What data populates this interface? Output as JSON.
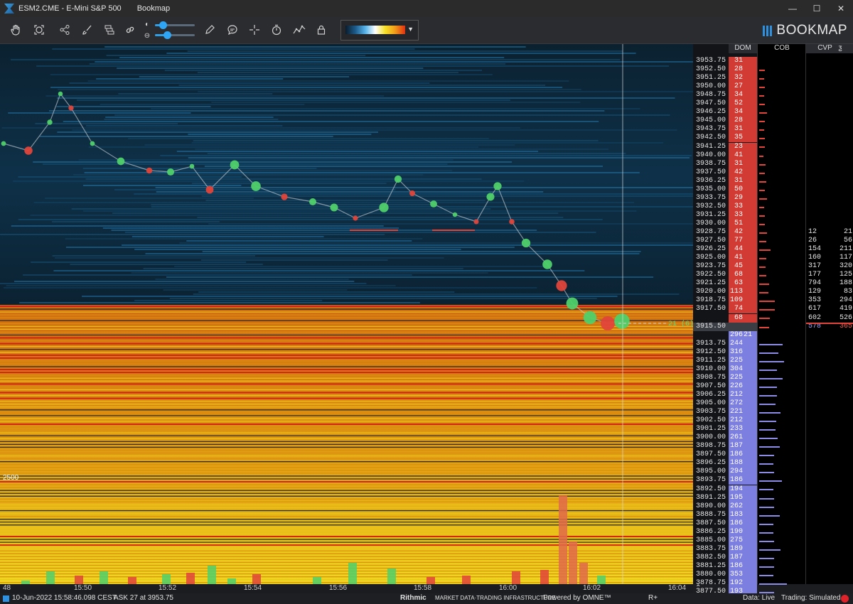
{
  "window": {
    "instrument_title": "ESM2.CME - E-Mini S&P 500",
    "app_name": "Bookmap",
    "minimize": "—",
    "maximize": "☐",
    "close": "✕"
  },
  "toolbar": {
    "icons": [
      "hand-icon",
      "target-icon",
      "share-icon",
      "brush-icon",
      "layers-icon",
      "link-icon",
      "pencil-icon",
      "chat-icon",
      "crosshair-icon",
      "stopwatch-icon",
      "line-chart-icon",
      "lock-icon"
    ],
    "brightness_slider_level": 0.2,
    "contrast_slider_level": 0.3,
    "heatmap_gradient": [
      "#0a1c2c",
      "#1d5a8a",
      "#57b3e8",
      "#ffffff",
      "#f6e027",
      "#f09a1a",
      "#e03010"
    ]
  },
  "brand": {
    "logo_text": "BOOKMAP",
    "accent": "#2e90e0"
  },
  "chart": {
    "left_label": "2500",
    "crosshair_readout": "21 (6)",
    "colors": {
      "buy": "#4fd06a",
      "sell": "#e0443a",
      "bid_bar": "#8c8ce6",
      "ask_bar": "#e0443a"
    }
  },
  "columns": {
    "dom": "DOM",
    "cob": "COB",
    "cvp": "CVP",
    "cvp_icon": "ƺ"
  },
  "ladder": [
    {
      "price": "3953.75",
      "size": "31",
      "side": "ask"
    },
    {
      "price": "3952.50",
      "size": "28",
      "side": "ask"
    },
    {
      "price": "3951.25",
      "size": "32",
      "side": "ask"
    },
    {
      "price": "3950.00",
      "size": "27",
      "side": "ask"
    },
    {
      "price": "3948.75",
      "size": "34",
      "side": "ask"
    },
    {
      "price": "3947.50",
      "size": "52",
      "side": "ask"
    },
    {
      "price": "3946.25",
      "size": "34",
      "side": "ask"
    },
    {
      "price": "3945.00",
      "size": "28",
      "side": "ask"
    },
    {
      "price": "3943.75",
      "size": "31",
      "side": "ask"
    },
    {
      "price": "3942.50",
      "size": "35",
      "side": "ask"
    },
    {
      "price": "3941.25",
      "size": "23",
      "side": "ask"
    },
    {
      "price": "3940.00",
      "size": "41",
      "side": "ask"
    },
    {
      "price": "3938.75",
      "size": "31",
      "side": "ask"
    },
    {
      "price": "3937.50",
      "size": "42",
      "side": "ask"
    },
    {
      "price": "3936.25",
      "size": "31",
      "side": "ask"
    },
    {
      "price": "3935.00",
      "size": "50",
      "side": "ask"
    },
    {
      "price": "3933.75",
      "size": "29",
      "side": "ask"
    },
    {
      "price": "3932.50",
      "size": "33",
      "side": "ask"
    },
    {
      "price": "3931.25",
      "size": "33",
      "side": "ask"
    },
    {
      "price": "3930.00",
      "size": "51",
      "side": "ask"
    },
    {
      "price": "3928.75",
      "size": "42",
      "side": "ask"
    },
    {
      "price": "3927.50",
      "size": "77",
      "side": "ask"
    },
    {
      "price": "3926.25",
      "size": "44",
      "side": "ask"
    },
    {
      "price": "3925.00",
      "size": "41",
      "side": "ask"
    },
    {
      "price": "3923.75",
      "size": "45",
      "side": "ask"
    },
    {
      "price": "3922.50",
      "size": "68",
      "side": "ask"
    },
    {
      "price": "3921.25",
      "size": "63",
      "side": "ask"
    },
    {
      "price": "3920.00",
      "size": "113",
      "side": "ask"
    },
    {
      "price": "3918.75",
      "size": "109",
      "side": "ask"
    },
    {
      "price": "3917.50",
      "size": "74",
      "side": "ask"
    },
    {
      "price": "",
      "size": "68",
      "side": "ask"
    },
    {
      "price": "3915.50",
      "size": "",
      "side": "last"
    },
    {
      "price": "",
      "size": "296",
      "side": "bid"
    },
    {
      "price": "3913.75",
      "size": "244",
      "side": "bid"
    },
    {
      "price": "3912.50",
      "size": "316",
      "side": "bid"
    },
    {
      "price": "3911.25",
      "size": "225",
      "side": "bid"
    },
    {
      "price": "3910.00",
      "size": "304",
      "side": "bid"
    },
    {
      "price": "3908.75",
      "size": "225",
      "side": "bid"
    },
    {
      "price": "3907.50",
      "size": "226",
      "side": "bid"
    },
    {
      "price": "3906.25",
      "size": "212",
      "side": "bid"
    },
    {
      "price": "3905.00",
      "size": "272",
      "side": "bid"
    },
    {
      "price": "3903.75",
      "size": "221",
      "side": "bid"
    },
    {
      "price": "3902.50",
      "size": "212",
      "side": "bid"
    },
    {
      "price": "3901.25",
      "size": "233",
      "side": "bid"
    },
    {
      "price": "3900.00",
      "size": "261",
      "side": "bid"
    },
    {
      "price": "3898.75",
      "size": "187",
      "side": "bid"
    },
    {
      "price": "3897.50",
      "size": "186",
      "side": "bid"
    },
    {
      "price": "3896.25",
      "size": "188",
      "side": "bid"
    },
    {
      "price": "3895.00",
      "size": "294",
      "side": "bid"
    },
    {
      "price": "3893.75",
      "size": "186",
      "side": "bid"
    },
    {
      "price": "3892.50",
      "size": "194",
      "side": "bid"
    },
    {
      "price": "3891.25",
      "size": "195",
      "side": "bid"
    },
    {
      "price": "3890.00",
      "size": "262",
      "side": "bid"
    },
    {
      "price": "3888.75",
      "size": "183",
      "side": "bid"
    },
    {
      "price": "3887.50",
      "size": "186",
      "side": "bid"
    },
    {
      "price": "3886.25",
      "size": "190",
      "side": "bid"
    },
    {
      "price": "3885.00",
      "size": "275",
      "side": "bid"
    },
    {
      "price": "3883.75",
      "size": "189",
      "side": "bid"
    },
    {
      "price": "3882.50",
      "size": "187",
      "side": "bid"
    },
    {
      "price": "3881.25",
      "size": "186",
      "side": "bid"
    },
    {
      "price": "3880.00",
      "size": "353",
      "side": "bid"
    },
    {
      "price": "3878.75",
      "size": "192",
      "side": "bid"
    },
    {
      "price": "3877.50",
      "size": "193",
      "side": "bid"
    }
  ],
  "bid_marker": "21",
  "cvp": [
    {
      "a": "12",
      "b": "21"
    },
    {
      "a": "26",
      "b": "56"
    },
    {
      "a": "154",
      "b": "211"
    },
    {
      "a": "160",
      "b": "117"
    },
    {
      "a": "317",
      "b": "320"
    },
    {
      "a": "177",
      "b": "125"
    },
    {
      "a": "794",
      "b": "188"
    },
    {
      "a": "129",
      "b": "83"
    },
    {
      "a": "353",
      "b": "294"
    },
    {
      "a": "617",
      "b": "419"
    },
    {
      "a": "602",
      "b": "526"
    },
    {
      "a": "578",
      "b": "365"
    }
  ],
  "time_axis": [
    "48",
    "15:50",
    "15:52",
    "15:54",
    "15:56",
    "15:58",
    "16:00",
    "16:02",
    "16:04"
  ],
  "status": {
    "datetime": "10-Jun-2022 15:58:46.098 CEST",
    "ask": "ASK 27 at 3953.75",
    "rithmic": "Rithmic",
    "rithmic_tag": "MARKET DATA·TRADING INFRASTRUCTURE",
    "omne": "Powered by OMNE™",
    "replay": "R+",
    "data": "Data: Live",
    "trading": "Trading: Simulated"
  }
}
